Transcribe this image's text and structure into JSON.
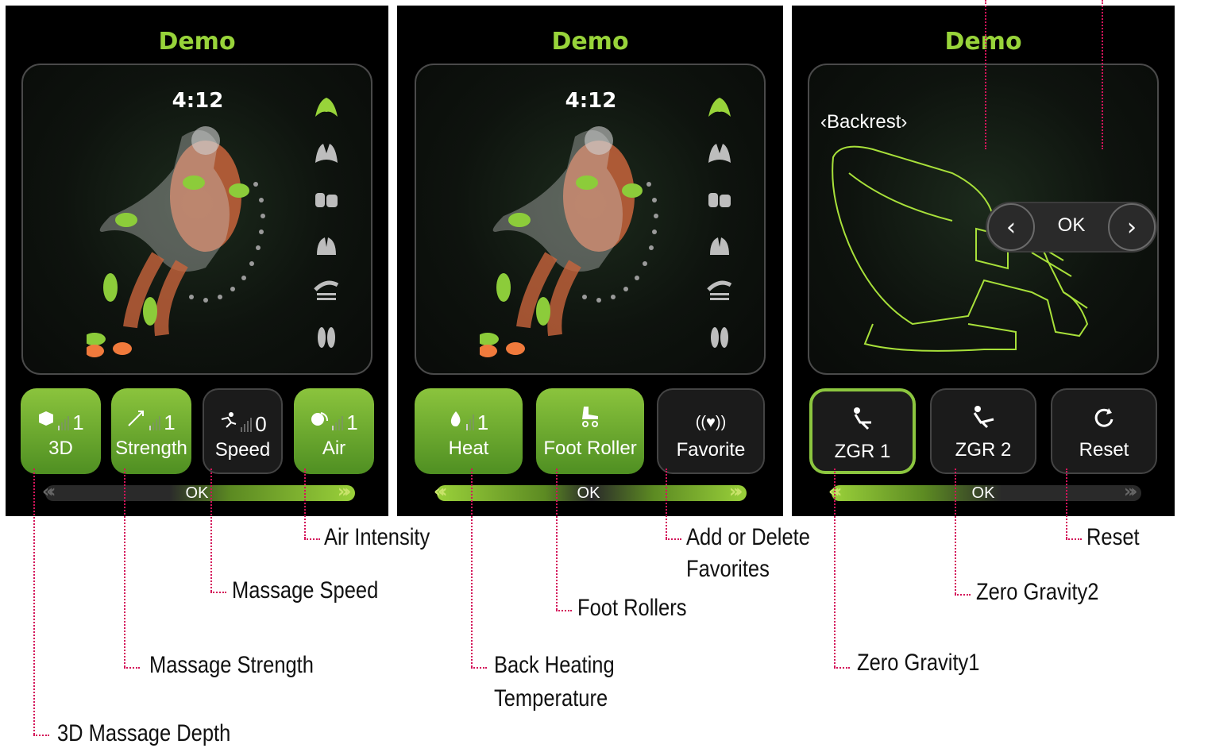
{
  "screens": [
    {
      "title": "Demo",
      "timer": "4:12",
      "buttons": [
        {
          "label": "3D",
          "level": "1"
        },
        {
          "label": "Strength",
          "level": "1"
        },
        {
          "label": "Speed",
          "level": "0"
        },
        {
          "label": "Air",
          "level": "1"
        }
      ],
      "ok_label": "OK"
    },
    {
      "title": "Demo",
      "timer": "4:12",
      "buttons": [
        {
          "label": "Heat",
          "level": "1"
        },
        {
          "label": "Foot Roller"
        },
        {
          "label": "Favorite"
        }
      ],
      "ok_label": "OK"
    },
    {
      "title": "Demo",
      "section_label": "‹Backrest›",
      "nav_ok": "OK",
      "nav_prev": "‹",
      "nav_next": "›",
      "buttons": [
        {
          "label": "ZGR 1"
        },
        {
          "label": "ZGR 2"
        },
        {
          "label": "Reset"
        }
      ],
      "ok_label": "OK"
    }
  ],
  "callouts": {
    "depth": "3D Massage Depth",
    "strength": "Massage Strength",
    "speed": "Massage Speed",
    "air": "Air Intensity",
    "heat_line1": "Back Heating",
    "heat_line2": "Temperature",
    "foot": "Foot Rollers",
    "fav_line1": "Add or Delete",
    "fav_line2": "Favorites",
    "zg1": "Zero Gravity1",
    "zg2": "Zero Gravity2",
    "reset": "Reset"
  },
  "colors": {
    "accent": "#98d43a",
    "button_on": "#6fae2e",
    "callout_line": "#d4145a"
  }
}
